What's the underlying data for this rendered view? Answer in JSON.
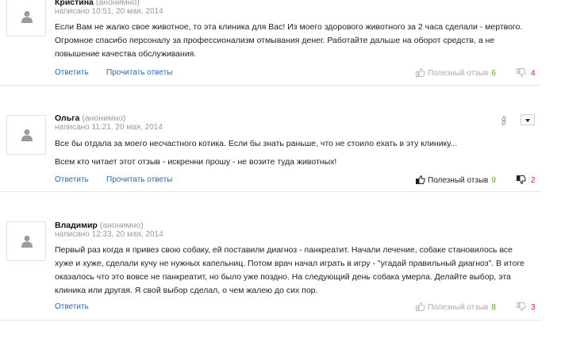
{
  "reviews": [
    {
      "author": "Кристина",
      "anon": "(анонимно)",
      "meta": "написано 10:51, 20 мая, 2014",
      "paragraphs": [
        "Если Вам не жалко свое животное, то эта клиника для Вас! Из моего здорового животного за 2 часа сделали - мертвого. Огромное спасибо персоналу за профессионализм отмывания денег. Работайте дальше на оборот средств, а не повышение качества обслуживания."
      ],
      "reply_label": "Ответить",
      "read_replies_label": "Прочитать ответы",
      "useful_label": "Полезный отзыв",
      "useful_count": "6",
      "dislike_count": "4"
    },
    {
      "author": "Ольга",
      "anon": "(анонимно)",
      "meta": "написано 11:21, 20 мая, 2014",
      "paragraphs": [
        "Все бы отдала за моего несчастного котика. Если бы знать раньше, что не стоило ехать в эту клинику...",
        "Всем кто читает этот отзыв - искренни прошу - не возите туда животных!"
      ],
      "reply_label": "Ответить",
      "read_replies_label": "Прочитать ответы",
      "useful_label": "Полезный отзыв",
      "useful_count": "9",
      "dislike_count": "2"
    },
    {
      "author": "Владимир",
      "anon": "(анонимно)",
      "meta": "написано 12:33, 20 мая, 2014",
      "paragraphs": [
        "Первый раз когда я привез свою собаку, ей поставили диагноз - панкреатит. Начали лечение, собаке становилось все хуже и хуже, сделали кучу не нужных капельниц. Потом врач начал играть в игру - \"угадай правильный диагноз\". В итоге оказалось что это вовсе не панкреатит, но было уже поздно. На следующий день собака умерла. Делайте выбор, эта клиника или другая. Я свой выбор сделал, о чем жалею до сих пор."
      ],
      "reply_label": "Ответить",
      "useful_label": "Полезный отзыв",
      "useful_count": "8",
      "dislike_count": "3"
    }
  ],
  "colors": {
    "link": "#2b6ab0",
    "useful_count": "#5aa02c",
    "dislike_count": "#cc2222",
    "muted": "#9a9a9a"
  },
  "icons": {
    "avatar": "user-silhouette-icon",
    "useful": "thumbs-up-icon",
    "dislike": "thumbs-down-icon",
    "permalink": "link-icon",
    "menu": "chevron-down-icon"
  }
}
